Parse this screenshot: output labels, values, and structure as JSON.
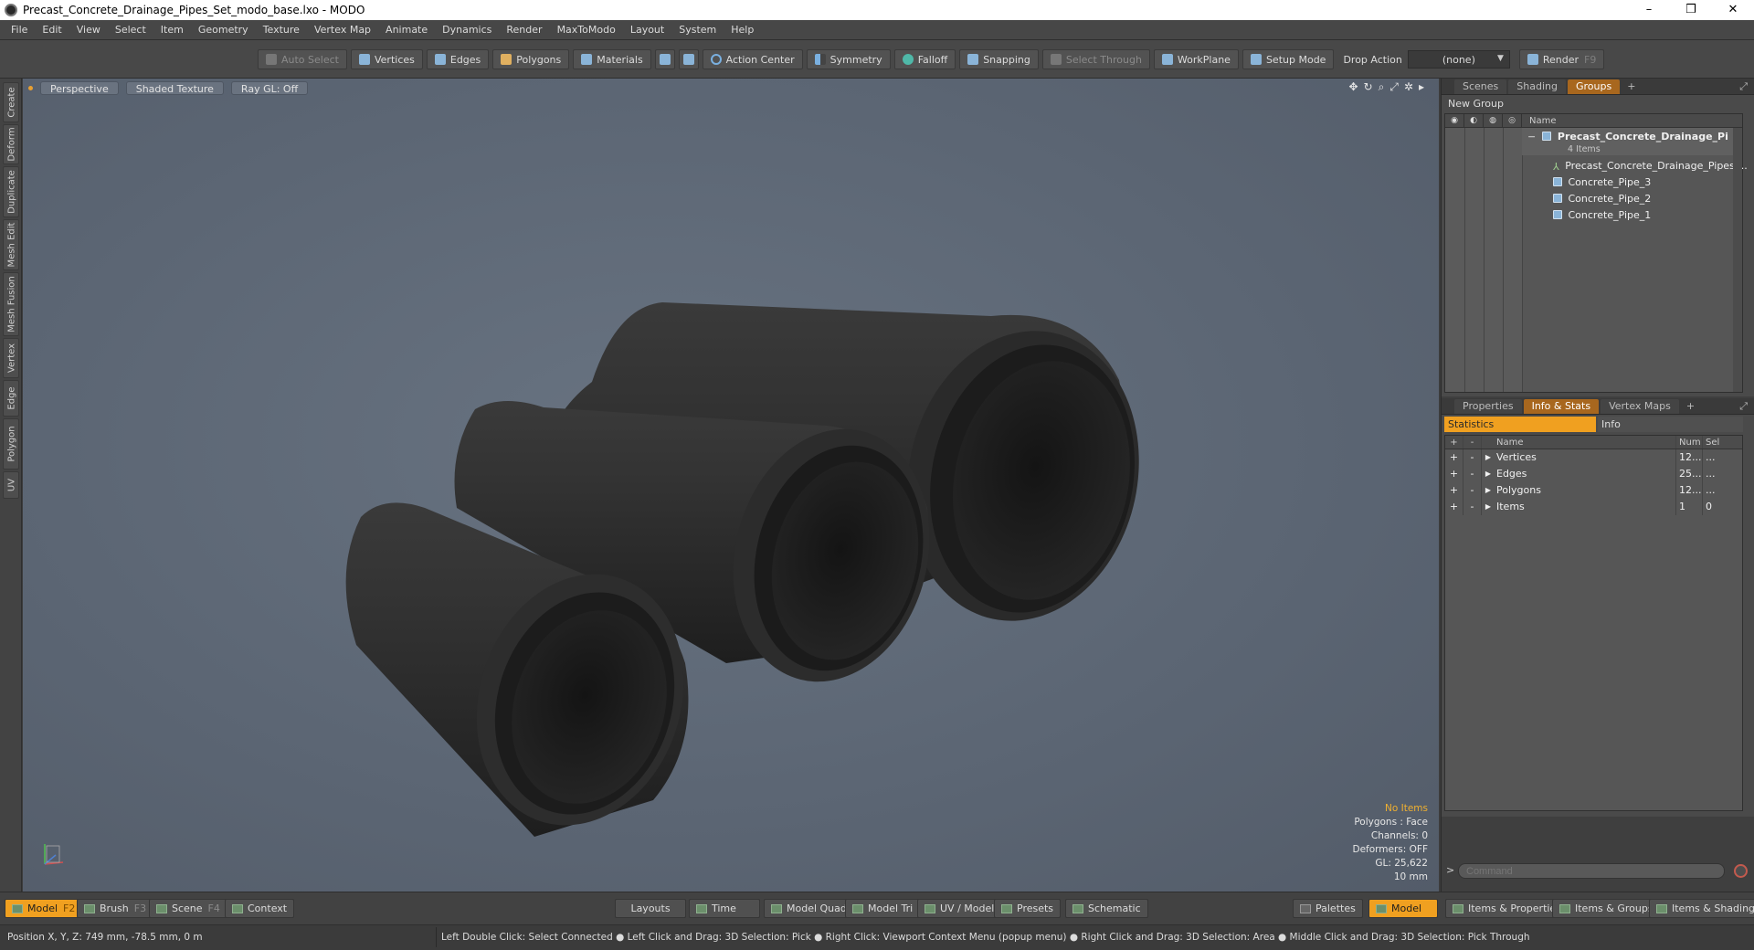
{
  "window": {
    "title": "Precast_Concrete_Drainage_Pipes_Set_modo_base.lxo - MODO",
    "controls": [
      "–",
      "❒",
      "✕"
    ]
  },
  "menu": [
    "File",
    "Edit",
    "View",
    "Select",
    "Item",
    "Geometry",
    "Texture",
    "Vertex Map",
    "Animate",
    "Dynamics",
    "Render",
    "MaxToModo",
    "Layout",
    "System",
    "Help"
  ],
  "toolbar": {
    "auto_select": "Auto Select",
    "vertices": "Vertices",
    "edges": "Edges",
    "polygons": "Polygons",
    "materials": "Materials",
    "action_center": "Action Center",
    "symmetry": "Symmetry",
    "falloff": "Falloff",
    "snapping": "Snapping",
    "select_through": "Select Through",
    "workplane": "WorkPlane",
    "setup_mode": "Setup Mode",
    "drop_action_label": "Drop Action",
    "drop_action_value": "(none)",
    "render": "Render",
    "render_shortcut": "F9"
  },
  "left_tabs": [
    "Create",
    "Deform",
    "Duplicate",
    "Mesh Edit",
    "Mesh Fusion",
    "Vertex",
    "Edge",
    "Polygon",
    "UV"
  ],
  "viewport": {
    "view": "Perspective",
    "shading": "Shaded Texture",
    "raygl": "Ray GL: Off",
    "info": {
      "selection": "No Items",
      "polygons": "Polygons : Face",
      "channels": "Channels: 0",
      "deformers": "Deformers: OFF",
      "gl": "GL: 25,622",
      "grid": "10 mm"
    }
  },
  "groups_panel": {
    "tabs": [
      "Scenes",
      "Shading",
      "Groups"
    ],
    "active_tab": "Groups",
    "new_group": "New Group",
    "name_header": "Name",
    "root": "Precast_Concrete_Drainage_Pi",
    "root_count": "4 Items",
    "children": [
      "Precast_Concrete_Drainage_Pipes ...",
      "Concrete_Pipe_3",
      "Concrete_Pipe_2",
      "Concrete_Pipe_1"
    ]
  },
  "stats_panel": {
    "tabs": [
      "Properties",
      "Info & Stats",
      "Vertex Maps"
    ],
    "active_tab": "Info & Stats",
    "sub_tabs": [
      "Statistics",
      "Info"
    ],
    "headers": {
      "name": "Name",
      "num": "Num",
      "sel": "Sel"
    },
    "rows": [
      {
        "name": "Vertices",
        "num": "12...",
        "sel": "..."
      },
      {
        "name": "Edges",
        "num": "25...",
        "sel": "..."
      },
      {
        "name": "Polygons",
        "num": "12...",
        "sel": "..."
      },
      {
        "name": "Items",
        "num": "1",
        "sel": "0"
      }
    ]
  },
  "command": {
    "placeholder": "Command",
    "prompt": ">"
  },
  "bottom_bar": {
    "model": "Model",
    "model_key": "F2",
    "brush": "Brush",
    "brush_key": "F3",
    "scene": "Scene",
    "scene_key": "F4",
    "context": "Context",
    "layouts": "Layouts",
    "time": "Time",
    "model_quad": "Model Quad",
    "model_tri": "Model Tri",
    "uv_model": "UV / Model",
    "presets": "Presets",
    "schematic": "Schematic",
    "palettes": "Palettes",
    "model_right": "Model",
    "items_properties": "Items & Properties",
    "items_groups": "Items & Groups",
    "items_shading": "Items & Shading"
  },
  "status": {
    "position": "Position X, Y, Z:   749 mm, -78.5 mm, 0 m",
    "hints": "Left Double Click: Select Connected ● Left Click and Drag: 3D Selection: Pick ● Right Click: Viewport Context Menu (popup menu) ● Right Click and Drag: 3D Selection: Area ● Middle Click and Drag: 3D Selection: Pick Through"
  },
  "colors": {
    "accent": "#f0a020",
    "viewport_bg": "#5f6976",
    "tab_active": "#a8671e"
  }
}
